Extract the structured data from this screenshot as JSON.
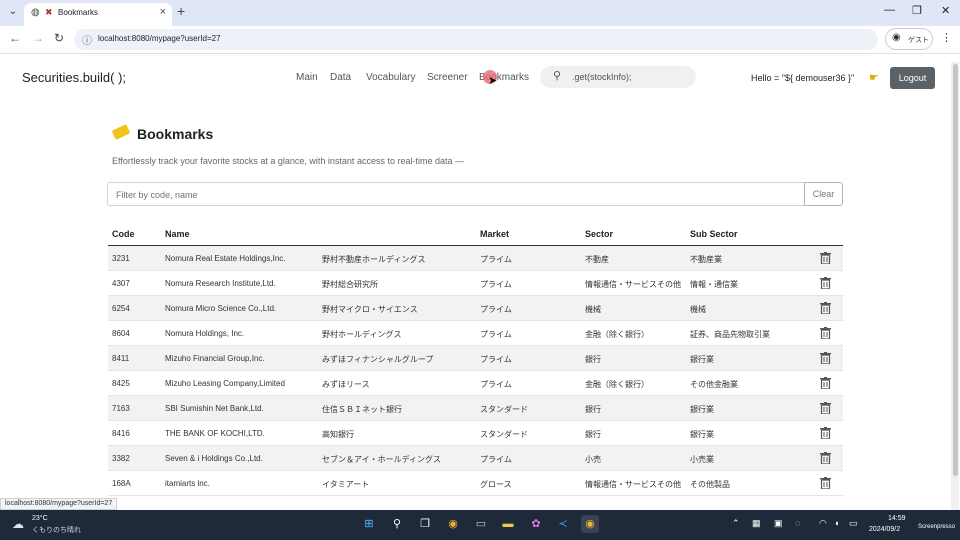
{
  "browser": {
    "tab_title": "Bookmarks",
    "url": "localhost:8080/mypage?userId=27",
    "guest_label": "ゲスト",
    "status_url": "localhost:8080/mypage?userId=27"
  },
  "header": {
    "brand": "Securities.build( );",
    "nav": [
      "Main",
      "Data",
      "Vocabulary",
      "Screener",
      "Bookmarks"
    ],
    "search_text": ".get(stockInfo);",
    "greeting": "Hello = \"${ demouser36 }\"",
    "logout_label": "Logout"
  },
  "page": {
    "title": "Bookmarks",
    "subtitle": "Effortlessly track your favorite stocks at a glance, with instant access to real-time data —",
    "filter_placeholder": "Filter by code, name",
    "clear_label": "Clear"
  },
  "table": {
    "headers": [
      "Code",
      "Name",
      "Market",
      "Sector",
      "Sub Sector"
    ],
    "rows": [
      {
        "code": "3231",
        "name_en": "Nomura Real Estate Holdings,Inc.",
        "name_jp": "野村不動産ホールディングス",
        "market": "プライム",
        "sector": "不動産",
        "subsector": "不動産業"
      },
      {
        "code": "4307",
        "name_en": "Nomura Research Institute,Ltd.",
        "name_jp": "野村総合研究所",
        "market": "プライム",
        "sector": "情報通信・サービスその他",
        "subsector": "情報・通信業"
      },
      {
        "code": "6254",
        "name_en": "Nomura Micro Science Co.,Ltd.",
        "name_jp": "野村マイクロ・サイエンス",
        "market": "プライム",
        "sector": "機械",
        "subsector": "機械"
      },
      {
        "code": "8604",
        "name_en": "Nomura Holdings, Inc.",
        "name_jp": "野村ホールディングス",
        "market": "プライム",
        "sector": "金融（除く銀行）",
        "subsector": "証券、商品先物取引業"
      },
      {
        "code": "8411",
        "name_en": "Mizuho Financial Group,Inc.",
        "name_jp": "みずほフィナンシャルグループ",
        "market": "プライム",
        "sector": "銀行",
        "subsector": "銀行業"
      },
      {
        "code": "8425",
        "name_en": "Mizuho Leasing Company,Limited",
        "name_jp": "みずほリース",
        "market": "プライム",
        "sector": "金融（除く銀行）",
        "subsector": "その他金融業"
      },
      {
        "code": "7163",
        "name_en": "SBI Sumishin Net Bank,Ltd.",
        "name_jp": "住信ＳＢＩネット銀行",
        "market": "スタンダード",
        "sector": "銀行",
        "subsector": "銀行業"
      },
      {
        "code": "8416",
        "name_en": "THE BANK OF KOCHI,LTD.",
        "name_jp": "高知銀行",
        "market": "スタンダード",
        "sector": "銀行",
        "subsector": "銀行業"
      },
      {
        "code": "3382",
        "name_en": "Seven & i Holdings Co.,Ltd.",
        "name_jp": "セブン＆アイ・ホールディングス",
        "market": "プライム",
        "sector": "小売",
        "subsector": "小売業"
      },
      {
        "code": "168A",
        "name_en": "itamiarts inc.",
        "name_jp": "イタミアート",
        "market": "グロース",
        "sector": "情報通信・サービスその他",
        "subsector": "その他製品"
      }
    ]
  },
  "taskbar": {
    "temperature": "23°C",
    "weather": "くもりのち晴れ",
    "time": "14:59",
    "date": "2024/09/2",
    "watermark": "Screenpresso"
  },
  "colors": {
    "tabbar": "#dfe6f5",
    "logout_button": "#5a6268",
    "bookmark_icon": "#f0c419",
    "taskbar": "#1e2a3a"
  }
}
